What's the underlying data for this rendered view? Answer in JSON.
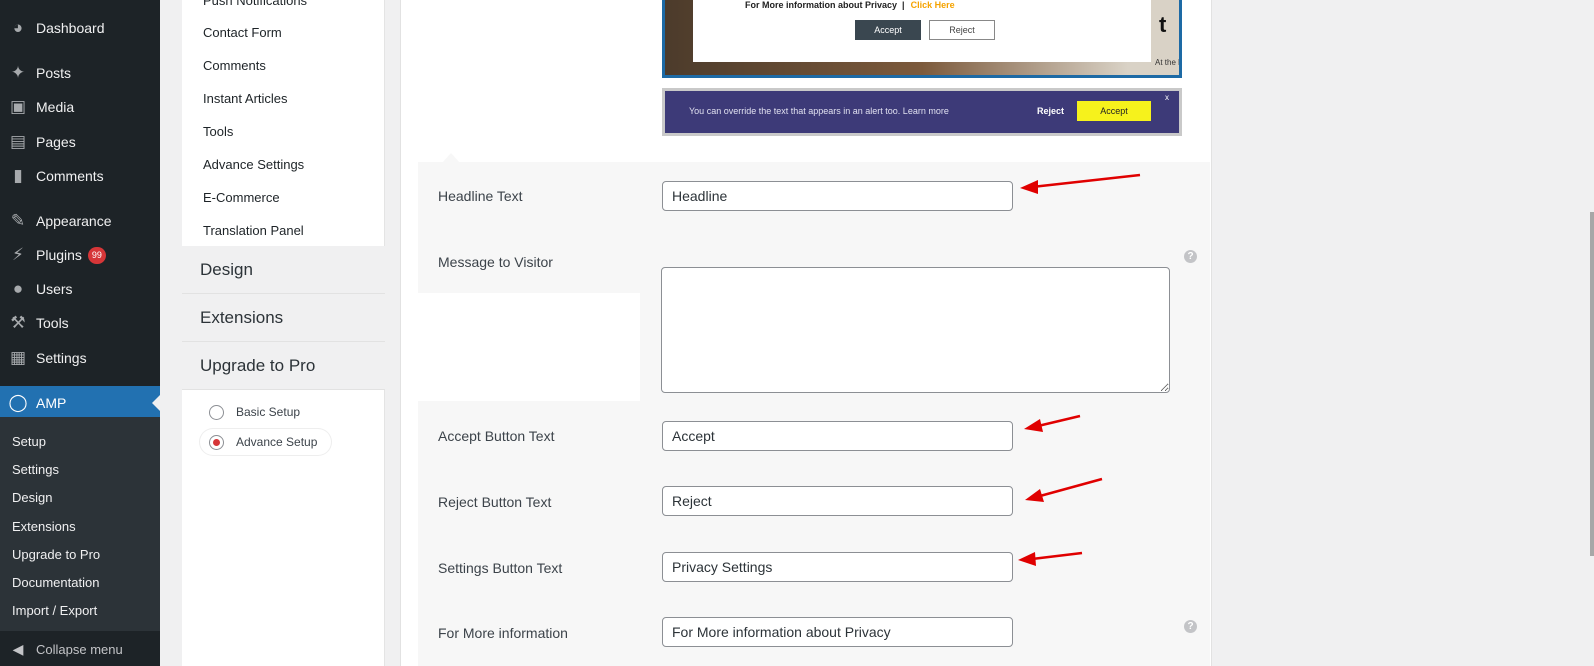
{
  "sidebar": {
    "items": [
      {
        "label": "Dashboard",
        "icon": "dashboard-icon"
      },
      {
        "label": "Posts",
        "icon": "pin-icon"
      },
      {
        "label": "Media",
        "icon": "media-icon"
      },
      {
        "label": "Pages",
        "icon": "pages-icon"
      },
      {
        "label": "Comments",
        "icon": "comment-icon"
      },
      {
        "label": "Appearance",
        "icon": "brush-icon"
      },
      {
        "label": "Plugins",
        "icon": "plugin-icon",
        "badge": "99"
      },
      {
        "label": "Users",
        "icon": "user-icon"
      },
      {
        "label": "Tools",
        "icon": "wrench-icon"
      },
      {
        "label": "Settings",
        "icon": "sliders-icon"
      },
      {
        "label": "AMP",
        "icon": "amp-bolt-icon"
      }
    ],
    "submenu": [
      "Setup",
      "Settings",
      "Design",
      "Extensions",
      "Upgrade to Pro",
      "Documentation",
      "Import / Export"
    ],
    "collapse_label": "Collapse menu"
  },
  "settings_nav": {
    "links": [
      "Push Notifications",
      "Contact Form",
      "Comments",
      "Instant Articles",
      "Tools",
      "Advance Settings",
      "E-Commerce",
      "Translation Panel"
    ],
    "sections": [
      "Design",
      "Extensions",
      "Upgrade to Pro"
    ],
    "setup_options": [
      {
        "label": "Basic Setup",
        "selected": false
      },
      {
        "label": "Advance Setup",
        "selected": true
      }
    ]
  },
  "preview_popup": {
    "info_text": "For More information about Privacy",
    "separator": "|",
    "link_text": "Click Here",
    "accept": "Accept",
    "reject": "Reject",
    "side_text": "At the height of America's odd",
    "side_letter": "t"
  },
  "preview_bar": {
    "message": "You can override the text that appears in an alert too. Learn more",
    "reject": "Reject",
    "accept": "Accept",
    "close": "x"
  },
  "form": {
    "headline_label": "Headline Text",
    "headline_value": "Headline",
    "message_label": "Message to Visitor",
    "message_value": "",
    "accept_label": "Accept Button Text",
    "accept_value": "Accept",
    "reject_label": "Reject Button Text",
    "reject_value": "Reject",
    "settings_label": "Settings Button Text",
    "settings_value": "Privacy Settings",
    "more_info_label": "For More information",
    "more_info_value": "For More information about Privacy"
  },
  "colors": {
    "sidebar_bg": "#1d2327",
    "accent": "#2271b1",
    "badge": "#d63638",
    "arrow": "#e00000"
  }
}
